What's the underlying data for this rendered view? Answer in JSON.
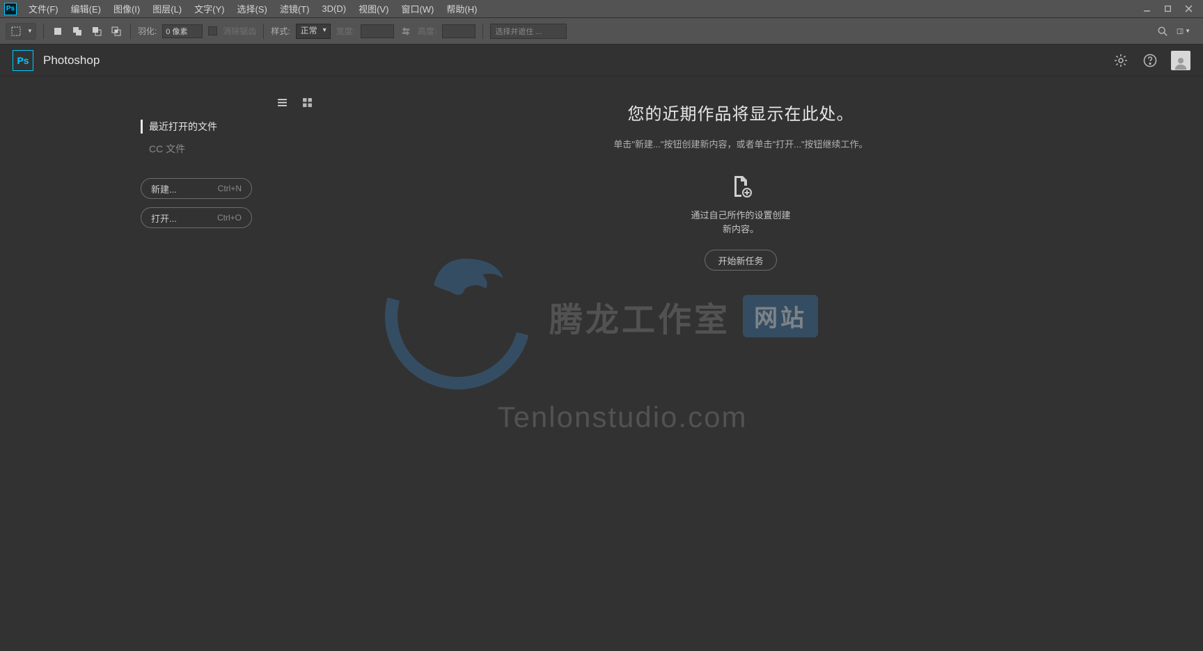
{
  "menubar": {
    "items": [
      "文件(F)",
      "编辑(E)",
      "图像(I)",
      "图层(L)",
      "文字(Y)",
      "选择(S)",
      "滤镜(T)",
      "3D(D)",
      "视图(V)",
      "窗口(W)",
      "帮助(H)"
    ]
  },
  "optbar": {
    "feather_label": "羽化:",
    "feather_value": "0 像素",
    "antialias": "消除锯齿",
    "style_label": "样式:",
    "style_value": "正常",
    "width_label": "宽度:",
    "height_label": "高度:",
    "mask_placeholder": "选择并遮住 ..."
  },
  "header": {
    "app_title": "Photoshop"
  },
  "sidebar": {
    "nav": [
      {
        "label": "最近打开的文件",
        "active": true
      },
      {
        "label": "CC 文件",
        "active": false
      }
    ],
    "buttons": [
      {
        "label": "新建...",
        "shortcut": "Ctrl+N"
      },
      {
        "label": "打开...",
        "shortcut": "Ctrl+O"
      }
    ]
  },
  "content": {
    "hero_title": "您的近期作品将显示在此处。",
    "hero_sub": "单击\"新建...\"按钮创建新内容，或者单击\"打开...\"按钮继续工作。",
    "hero_desc1": "通过自己所作的设置创建",
    "hero_desc2": "新内容。",
    "hero_button": "开始新任务"
  },
  "watermark": {
    "title": "腾龙工作室",
    "badge": "网站",
    "url": "Tenlonstudio.com"
  },
  "logo_text": "Ps"
}
